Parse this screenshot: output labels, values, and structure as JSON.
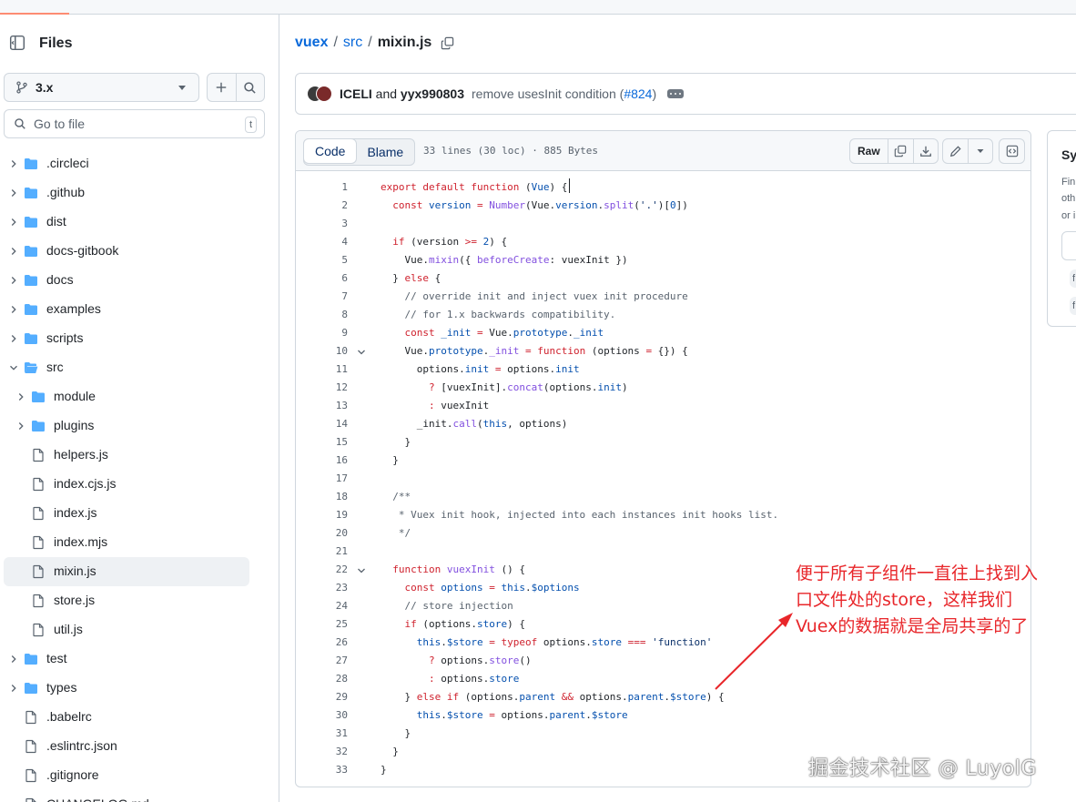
{
  "sidebar": {
    "title": "Files",
    "branch": "3.x",
    "search_placeholder": "Go to file",
    "search_shortcut": "t",
    "tree": [
      {
        "name": ".circleci",
        "type": "dir",
        "depth": 0,
        "open": false
      },
      {
        "name": ".github",
        "type": "dir",
        "depth": 0,
        "open": false
      },
      {
        "name": "dist",
        "type": "dir",
        "depth": 0,
        "open": false
      },
      {
        "name": "docs-gitbook",
        "type": "dir",
        "depth": 0,
        "open": false
      },
      {
        "name": "docs",
        "type": "dir",
        "depth": 0,
        "open": false
      },
      {
        "name": "examples",
        "type": "dir",
        "depth": 0,
        "open": false
      },
      {
        "name": "scripts",
        "type": "dir",
        "depth": 0,
        "open": false
      },
      {
        "name": "src",
        "type": "dir",
        "depth": 0,
        "open": true
      },
      {
        "name": "module",
        "type": "dir",
        "depth": 1,
        "open": false
      },
      {
        "name": "plugins",
        "type": "dir",
        "depth": 1,
        "open": false
      },
      {
        "name": "helpers.js",
        "type": "file",
        "depth": 1
      },
      {
        "name": "index.cjs.js",
        "type": "file",
        "depth": 1
      },
      {
        "name": "index.js",
        "type": "file",
        "depth": 1
      },
      {
        "name": "index.mjs",
        "type": "file",
        "depth": 1
      },
      {
        "name": "mixin.js",
        "type": "file",
        "depth": 1,
        "active": true
      },
      {
        "name": "store.js",
        "type": "file",
        "depth": 1
      },
      {
        "name": "util.js",
        "type": "file",
        "depth": 1
      },
      {
        "name": "test",
        "type": "dir",
        "depth": 0,
        "open": false
      },
      {
        "name": "types",
        "type": "dir",
        "depth": 0,
        "open": false
      },
      {
        "name": ".babelrc",
        "type": "file",
        "depth": 0
      },
      {
        "name": ".eslintrc.json",
        "type": "file",
        "depth": 0
      },
      {
        "name": ".gitignore",
        "type": "file",
        "depth": 0
      },
      {
        "name": "CHANGELOG.md",
        "type": "file",
        "depth": 0
      }
    ]
  },
  "breadcrumb": {
    "repo": "vuex",
    "dir": "src",
    "file": "mixin.js",
    "sep": "/"
  },
  "commit": {
    "author1": "ICELI",
    "and": "and",
    "author2": "yyx990803",
    "message": "remove usesInit condition (",
    "pr": "#824",
    "message_end": ")"
  },
  "code_header": {
    "tab_code": "Code",
    "tab_blame": "Blame",
    "meta": "33 lines (30 loc) · 885 Bytes",
    "raw": "Raw"
  },
  "code_lines": [
    {
      "n": "1",
      "fold": false,
      "html": "<span class=\"k\">export</span> <span class=\"k\">default</span> <span class=\"k\">function</span> (<span class=\"p\">Vue</span>) {<span class=\"cursor\"></span>"
    },
    {
      "n": "2",
      "fold": false,
      "html": "  <span class=\"k\">const</span> <span class=\"p\">version</span> <span class=\"k\">=</span> <span class=\"f\">Number</span>(Vue.<span class=\"p\">version</span>.<span class=\"f\">split</span>(<span class=\"s\">'.'</span>)[<span class=\"p\">0</span>])"
    },
    {
      "n": "3",
      "fold": false,
      "html": ""
    },
    {
      "n": "4",
      "fold": false,
      "html": "  <span class=\"k\">if</span> (version <span class=\"k\">&gt;=</span> <span class=\"p\">2</span>) {"
    },
    {
      "n": "5",
      "fold": false,
      "html": "    Vue.<span class=\"f\">mixin</span>({ <span class=\"f\">beforeCreate</span>: vuexInit })"
    },
    {
      "n": "6",
      "fold": false,
      "html": "  } <span class=\"k\">else</span> {"
    },
    {
      "n": "7",
      "fold": false,
      "html": "    <span class=\"c\">// override init and inject vuex init procedure</span>"
    },
    {
      "n": "8",
      "fold": false,
      "html": "    <span class=\"c\">// for 1.x backwards compatibility.</span>"
    },
    {
      "n": "9",
      "fold": false,
      "html": "    <span class=\"k\">const</span> <span class=\"p\">_init</span> <span class=\"k\">=</span> Vue.<span class=\"p\">prototype</span>.<span class=\"p\">_init</span>"
    },
    {
      "n": "10",
      "fold": true,
      "html": "    Vue.<span class=\"p\">prototype</span>.<span class=\"f\">_init</span> <span class=\"k\">=</span> <span class=\"k\">function</span> (options <span class=\"k\">=</span> {}) {"
    },
    {
      "n": "11",
      "fold": false,
      "html": "      options.<span class=\"p\">init</span> <span class=\"k\">=</span> options.<span class=\"p\">init</span>"
    },
    {
      "n": "12",
      "fold": false,
      "html": "        <span class=\"k\">?</span> [vuexInit].<span class=\"f\">concat</span>(options.<span class=\"p\">init</span>)"
    },
    {
      "n": "13",
      "fold": false,
      "html": "        <span class=\"k\">:</span> vuexInit"
    },
    {
      "n": "14",
      "fold": false,
      "html": "      _init.<span class=\"f\">call</span>(<span class=\"p\">this</span>, options)"
    },
    {
      "n": "15",
      "fold": false,
      "html": "    }"
    },
    {
      "n": "16",
      "fold": false,
      "html": "  }"
    },
    {
      "n": "17",
      "fold": false,
      "html": ""
    },
    {
      "n": "18",
      "fold": false,
      "html": "  <span class=\"c\">/**</span>"
    },
    {
      "n": "19",
      "fold": false,
      "html": "<span class=\"c\">   * Vuex init hook, injected into each instances init hooks list.</span>"
    },
    {
      "n": "20",
      "fold": false,
      "html": "<span class=\"c\">   */</span>"
    },
    {
      "n": "21",
      "fold": false,
      "html": ""
    },
    {
      "n": "22",
      "fold": true,
      "html": "  <span class=\"k\">function</span> <span class=\"f\">vuexInit</span> () {"
    },
    {
      "n": "23",
      "fold": false,
      "html": "    <span class=\"k\">const</span> <span class=\"p\">options</span> <span class=\"k\">=</span> <span class=\"p\">this</span>.<span class=\"p\">$options</span>"
    },
    {
      "n": "24",
      "fold": false,
      "html": "    <span class=\"c\">// store injection</span>"
    },
    {
      "n": "25",
      "fold": false,
      "html": "    <span class=\"k\">if</span> (options.<span class=\"p\">store</span>) {"
    },
    {
      "n": "26",
      "fold": false,
      "html": "      <span class=\"p\">this</span>.<span class=\"p\">$store</span> <span class=\"k\">=</span> <span class=\"k\">typeof</span> options.<span class=\"p\">store</span> <span class=\"k\">===</span> <span class=\"s\">'function'</span>"
    },
    {
      "n": "27",
      "fold": false,
      "html": "        <span class=\"k\">?</span> options.<span class=\"f\">store</span>()"
    },
    {
      "n": "28",
      "fold": false,
      "html": "        <span class=\"k\">:</span> options.<span class=\"p\">store</span>"
    },
    {
      "n": "29",
      "fold": false,
      "html": "    } <span class=\"k\">else</span> <span class=\"k\">if</span> (options.<span class=\"p\">parent</span> <span class=\"k\">&amp;&amp;</span> options.<span class=\"p\">parent</span>.<span class=\"p\">$store</span>) {"
    },
    {
      "n": "30",
      "fold": false,
      "html": "      <span class=\"p\">this</span>.<span class=\"p\">$store</span> <span class=\"k\">=</span> options.<span class=\"p\">parent</span>.<span class=\"p\">$store</span>"
    },
    {
      "n": "31",
      "fold": false,
      "html": "    }"
    },
    {
      "n": "32",
      "fold": false,
      "html": "  }"
    },
    {
      "n": "33",
      "fold": false,
      "html": "}"
    }
  ],
  "right_panel": {
    "title": "Sy",
    "line1": "Fin",
    "line2": "oth",
    "line3": "or i",
    "chip": "f"
  },
  "annotation": {
    "line1": "便于所有子组件一直往上找到入",
    "line2": "口文件处的store，这样我们",
    "line3": "Vuex的数据就是全局共享的了",
    "color": "#e8262a"
  },
  "watermark": "掘金技术社区 @ LuyolG",
  "colors": {
    "accent_link": "#0969da",
    "keyword": "#cf222e",
    "function": "#8250df",
    "property": "#0550ae",
    "comment": "#59636e"
  }
}
